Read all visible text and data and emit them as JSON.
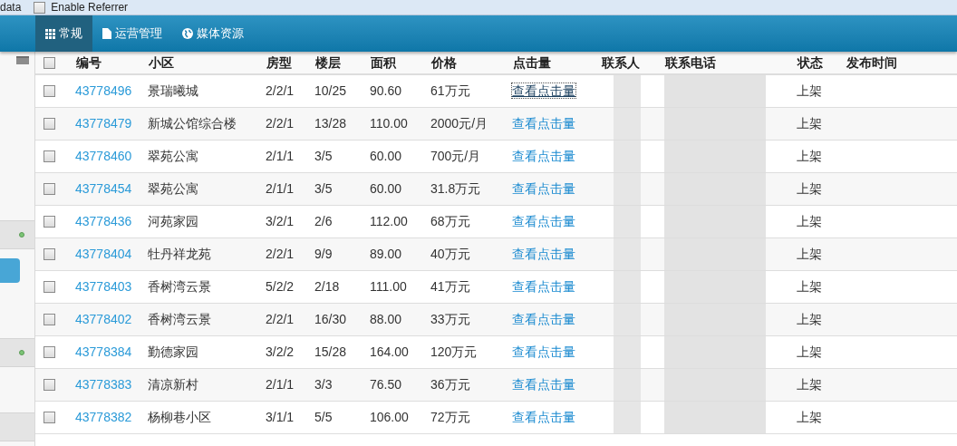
{
  "browser_bar": {
    "cut_text": "data",
    "checkbox": {
      "label": "Enable Referrer",
      "checked": false
    }
  },
  "nav": {
    "tabs": [
      {
        "label": "常规",
        "selected": true
      },
      {
        "label": "运营管理",
        "selected": false
      },
      {
        "label": "媒体资源",
        "selected": false
      }
    ]
  },
  "sidebar": {
    "items": [
      {
        "kind": "band",
        "status_dot": true
      },
      {
        "kind": "button"
      },
      {
        "kind": "band",
        "status_dot": true
      },
      {
        "kind": "band",
        "status_dot": false
      }
    ]
  },
  "table": {
    "select_all": {
      "checked": false
    },
    "columns": [
      "编号",
      "小区",
      "房型",
      "楼层",
      "面积",
      "价格",
      "点击量",
      "联系人",
      "联系电话",
      "状态",
      "发布时间"
    ],
    "rows": [
      {
        "checked": false,
        "id": "43778496",
        "community": "景瑞曦城",
        "layout": "2/2/1",
        "floor": "10/25",
        "area": "90.60",
        "price": "61万元",
        "clicks": "查看点击量",
        "clicks_visited": true,
        "status": "上架"
      },
      {
        "checked": false,
        "id": "43778479",
        "community": "新城公馆综合楼",
        "layout": "2/2/1",
        "floor": "13/28",
        "area": "110.00",
        "price": "2000元/月",
        "clicks": "查看点击量",
        "clicks_visited": false,
        "status": "上架"
      },
      {
        "checked": false,
        "id": "43778460",
        "community": "翠苑公寓",
        "layout": "2/1/1",
        "floor": "3/5",
        "area": "60.00",
        "price": "700元/月",
        "clicks": "查看点击量",
        "clicks_visited": false,
        "status": "上架"
      },
      {
        "checked": false,
        "id": "43778454",
        "community": "翠苑公寓",
        "layout": "2/1/1",
        "floor": "3/5",
        "area": "60.00",
        "price": "31.8万元",
        "clicks": "查看点击量",
        "clicks_visited": false,
        "status": "上架"
      },
      {
        "checked": false,
        "id": "43778436",
        "community": "河苑家园",
        "layout": "3/2/1",
        "floor": "2/6",
        "area": "112.00",
        "price": "68万元",
        "clicks": "查看点击量",
        "clicks_visited": false,
        "status": "上架"
      },
      {
        "checked": false,
        "id": "43778404",
        "community": "牡丹祥龙苑",
        "layout": "2/2/1",
        "floor": "9/9",
        "area": "89.00",
        "price": "40万元",
        "clicks": "查看点击量",
        "clicks_visited": false,
        "status": "上架"
      },
      {
        "checked": false,
        "id": "43778403",
        "community": "香树湾云景",
        "layout": "5/2/2",
        "floor": "2/18",
        "area": "111.00",
        "price": "41万元",
        "clicks": "查看点击量",
        "clicks_visited": false,
        "status": "上架"
      },
      {
        "checked": false,
        "id": "43778402",
        "community": "香树湾云景",
        "layout": "2/2/1",
        "floor": "16/30",
        "area": "88.00",
        "price": "33万元",
        "clicks": "查看点击量",
        "clicks_visited": false,
        "status": "上架"
      },
      {
        "checked": false,
        "id": "43778384",
        "community": "勤德家园",
        "layout": "3/2/2",
        "floor": "15/28",
        "area": "164.00",
        "price": "120万元",
        "clicks": "查看点击量",
        "clicks_visited": false,
        "status": "上架"
      },
      {
        "checked": false,
        "id": "43778383",
        "community": "清凉新村",
        "layout": "2/1/1",
        "floor": "3/3",
        "area": "76.50",
        "price": "36万元",
        "clicks": "查看点击量",
        "clicks_visited": false,
        "status": "上架"
      },
      {
        "checked": false,
        "id": "43778382",
        "community": "杨柳巷小区",
        "layout": "3/1/1",
        "floor": "5/5",
        "area": "106.00",
        "price": "72万元",
        "clicks": "查看点击量",
        "clicks_visited": false,
        "status": "上架"
      }
    ]
  }
}
